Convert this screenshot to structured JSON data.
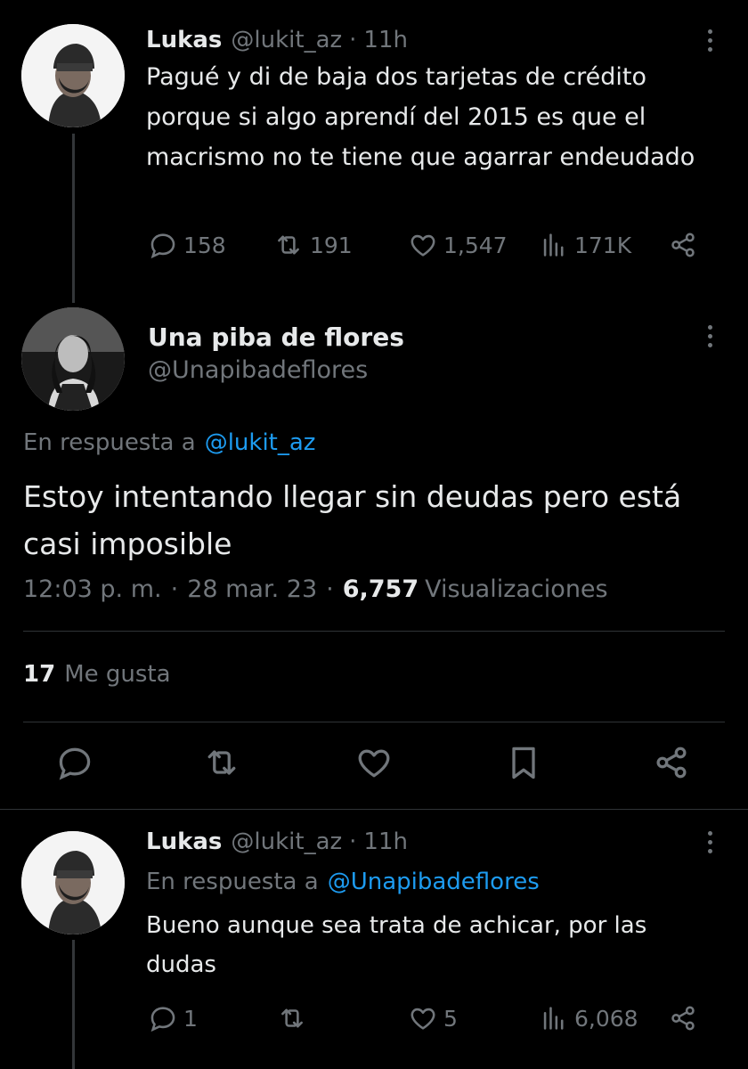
{
  "tweet1": {
    "name": "Lukas",
    "handle": "@lukit_az",
    "sep": "·",
    "time": "11h",
    "text": "Pagué y di de baja dos tarjetas de crédito porque si algo aprendí del 2015 es que el macrismo no te tiene que agarrar endeudado",
    "replies": "158",
    "retweets": "191",
    "likes": "1,547",
    "views": "171K"
  },
  "main": {
    "name": "Una piba de flores",
    "handle": "@Unapibadeflores",
    "reply_prefix": "En respuesta a",
    "reply_to": "@lukit_az",
    "text": "Estoy intentando llegar sin deudas pero está casi imposible",
    "time": "12:03 p. m.",
    "date": "28 mar. 23",
    "sep": "·",
    "views_count": "6,757",
    "views_label": "Visualizaciones",
    "likes_count": "17",
    "likes_label": "Me gusta"
  },
  "tweet3": {
    "name": "Lukas",
    "handle": "@lukit_az",
    "sep": "·",
    "time": "11h",
    "reply_prefix": "En respuesta a",
    "reply_to": "@Unapibadeflores",
    "text": "Bueno aunque sea trata de achicar, por las dudas",
    "replies": "1",
    "likes": "5",
    "views": "6,068"
  },
  "icons": {
    "reply": "reply-icon",
    "retweet": "retweet-icon",
    "like": "heart-icon",
    "views": "views-icon",
    "share": "share-icon",
    "bookmark": "bookmark-icon",
    "more": "more-icon"
  },
  "colors": {
    "link": "#1d9bf0",
    "muted": "#71767b",
    "text": "#e7e9ea",
    "background": "#000000"
  }
}
